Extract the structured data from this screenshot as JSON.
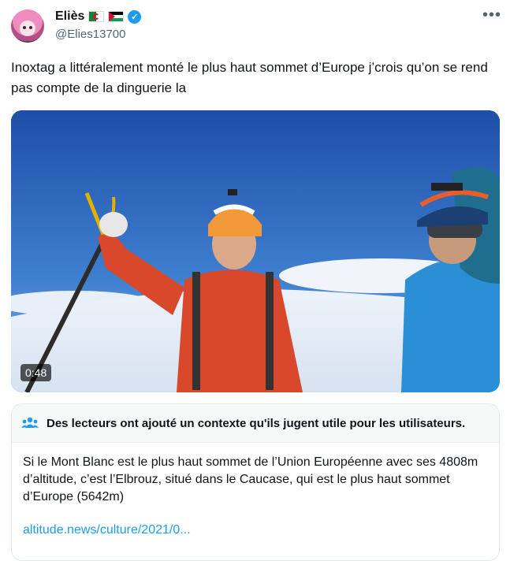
{
  "author": {
    "name": "Eliès",
    "handle": "@Elies13700",
    "flags": [
      "algeria-flag-icon",
      "palestine-flag-icon"
    ],
    "verified_icon": "verified-badge-icon"
  },
  "more_label": "•••",
  "tweet": {
    "text": "Inoxtag a littéralement monté le plus haut sommet d’Europe j’crois qu’on se rend pas compte de la dinguerie la"
  },
  "media": {
    "type": "video",
    "duration": "0:48"
  },
  "community_note": {
    "header": "Des lecteurs ont ajouté un contexte qu'ils jugent utile pour les utilisateurs.",
    "body": "Si le Mont Blanc est le plus haut sommet de l’Union Européenne avec ses 4808m d’altitude, c’est l’Elbrouz, situé dans le Caucase, qui est le plus haut sommet d’Europe (5642m)",
    "link": "altitude.news/culture/2021/0..."
  },
  "colors": {
    "accent": "#1d9bf0",
    "text": "#0f1419",
    "secondary": "#536471"
  }
}
